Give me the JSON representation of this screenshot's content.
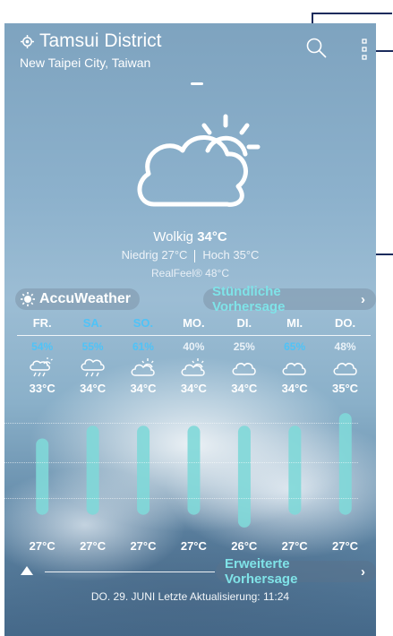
{
  "location": {
    "name": "Tamsui District",
    "region": "New Taipei City, Taiwan"
  },
  "current": {
    "condition": "Wolkig",
    "temp": "34°C",
    "low": "Niedrig 27°C",
    "high": "Hoch 35°C",
    "realfeel": "RealFeel® 48°C",
    "icon": "partly-cloudy-icon"
  },
  "provider": {
    "name": "AccuWeather"
  },
  "hourly_button": {
    "label": "Stündliche Vorhersage"
  },
  "forecast": [
    {
      "day": "FR.",
      "prob": "54%",
      "high": "33°C",
      "low": "27°C",
      "icon": "thunder-rain-icon",
      "day_color": "#ffffff",
      "prob_color": "#4fc3f7"
    },
    {
      "day": "SA.",
      "prob": "55%",
      "high": "34°C",
      "low": "27°C",
      "icon": "rain-icon",
      "day_color": "#4fc3f7",
      "prob_color": "#4fc3f7"
    },
    {
      "day": "SO.",
      "prob": "61%",
      "high": "34°C",
      "low": "27°C",
      "icon": "partly-cloudy-icon",
      "day_color": "#4fc3f7",
      "prob_color": "#4fc3f7"
    },
    {
      "day": "MO.",
      "prob": "40%",
      "high": "34°C",
      "low": "27°C",
      "icon": "partly-cloudy-icon",
      "day_color": "#ffffff",
      "prob_color": "#eaf2f8"
    },
    {
      "day": "DI.",
      "prob": "25%",
      "high": "34°C",
      "low": "26°C",
      "icon": "cloud-icon",
      "day_color": "#ffffff",
      "prob_color": "#eaf2f8"
    },
    {
      "day": "MI.",
      "prob": "65%",
      "high": "34°C",
      "low": "27°C",
      "icon": "cloud-icon",
      "day_color": "#ffffff",
      "prob_color": "#4fc3f7"
    },
    {
      "day": "DO.",
      "prob": "48%",
      "high": "35°C",
      "low": "27°C",
      "icon": "cloud-icon",
      "day_color": "#ffffff",
      "prob_color": "#eaf2f8"
    }
  ],
  "extended_button": {
    "label": "Erweiterte Vorhersage"
  },
  "update": {
    "text": "DO. 29. JUNI Letzte Aktualisierung: 11:24"
  },
  "colors": {
    "accent": "#7fe3e8",
    "bar": "#7fd8d8",
    "rain_prob": "#4fc3f7"
  }
}
